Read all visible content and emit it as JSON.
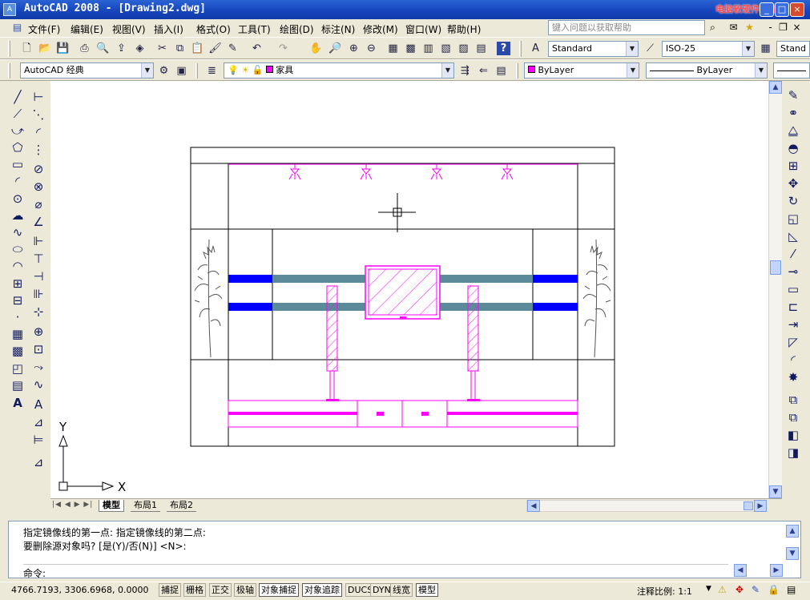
{
  "window": {
    "title": "AutoCAD 2008 - [Drawing2.dwg]",
    "watermark": "电脑软硬件教程网"
  },
  "menu": {
    "items": [
      "文件(F)",
      "编辑(E)",
      "视图(V)",
      "插入(I)",
      "格式(O)",
      "工具(T)",
      "绘图(D)",
      "标注(N)",
      "修改(M)",
      "窗口(W)",
      "帮助(H)"
    ],
    "help_placeholder": "键入问题以获取帮助"
  },
  "toolbar_styles": {
    "text_style": "Standard",
    "dim_style": "ISO-25",
    "table_style": "Stand"
  },
  "toolbar_layers": {
    "workspace": "AutoCAD 经典",
    "layer": "家具",
    "layer_color": "#ff00ff",
    "color": "ByLayer",
    "linetype": "ByLayer"
  },
  "layout_tabs": {
    "items": [
      "模型",
      "布局1",
      "布局2"
    ],
    "active": "模型"
  },
  "ucs": {
    "y_label": "Y",
    "x_label": "X"
  },
  "command": {
    "line1": "指定镜像线的第一点: 指定镜像线的第二点:",
    "line2": "要删除源对象吗? [是(Y)/否(N)] <N>:",
    "prompt": "命令:"
  },
  "status": {
    "coords": "4766.7193, 3306.6968, 0.0000",
    "toggles": [
      {
        "label": "捕捉",
        "on": false
      },
      {
        "label": "栅格",
        "on": false
      },
      {
        "label": "正交",
        "on": false
      },
      {
        "label": "极轴",
        "on": false
      },
      {
        "label": "对象捕捉",
        "on": true
      },
      {
        "label": "对象追踪",
        "on": true
      },
      {
        "label": "DUCS",
        "on": false
      },
      {
        "label": "DYN",
        "on": false
      },
      {
        "label": "线宽",
        "on": false
      },
      {
        "label": "模型",
        "on": true
      }
    ],
    "scale_label": "注释比例: 1:1"
  },
  "colors": {
    "drawing_magenta": "#ff00ff",
    "drawing_blue": "#0000ff",
    "drawing_teal": "#5b8b9a",
    "title_blue": "#1848c0"
  }
}
